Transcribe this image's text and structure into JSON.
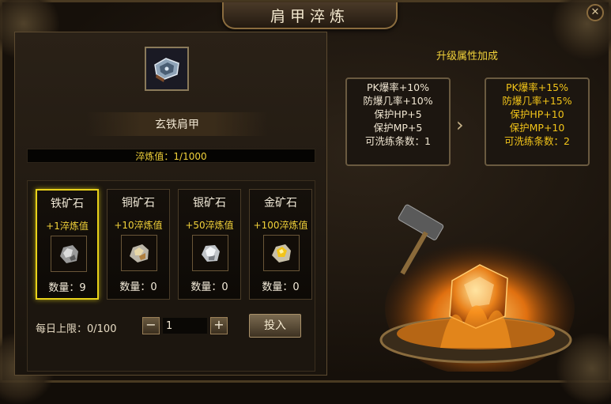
{
  "window": {
    "title": "肩甲淬炼"
  },
  "equipment": {
    "icon": "shoulder-armor-icon",
    "name": "玄铁肩甲",
    "refine_progress_label": "淬炼值：1/1000",
    "refine_current": 1,
    "refine_max": 1000
  },
  "ores": [
    {
      "name": "铁矿石",
      "bonus": "+1淬炼值",
      "count": "数量：9",
      "icon": "iron-ore-icon",
      "selected": true
    },
    {
      "name": "铜矿石",
      "bonus": "+10淬炼值",
      "count": "数量：0",
      "icon": "copper-ore-icon",
      "selected": false
    },
    {
      "name": "银矿石",
      "bonus": "+50淬炼值",
      "count": "数量：0",
      "icon": "silver-ore-icon",
      "selected": false
    },
    {
      "name": "金矿石",
      "bonus": "+100淬炼值",
      "count": "数量：0",
      "icon": "gold-ore-icon",
      "selected": false
    }
  ],
  "controls": {
    "daily_limit": "每日上限：0/100",
    "quantity": "1",
    "minus": "−",
    "plus": "+",
    "submit_label": "投入"
  },
  "attributes": {
    "title": "升级属性加成",
    "current": [
      "PK爆率+10%",
      "防爆几率+10%",
      "保护HP+5",
      "保护MP+5",
      "可洗练条数：1"
    ],
    "next": [
      "PK爆率+15%",
      "防爆几率+15%",
      "保护HP+10",
      "保护MP+10",
      "可洗练条数：2"
    ]
  },
  "colors": {
    "accent_yellow": "#f2d23a",
    "next_values": "#f2c419",
    "selected_border": "#e9d21a"
  }
}
